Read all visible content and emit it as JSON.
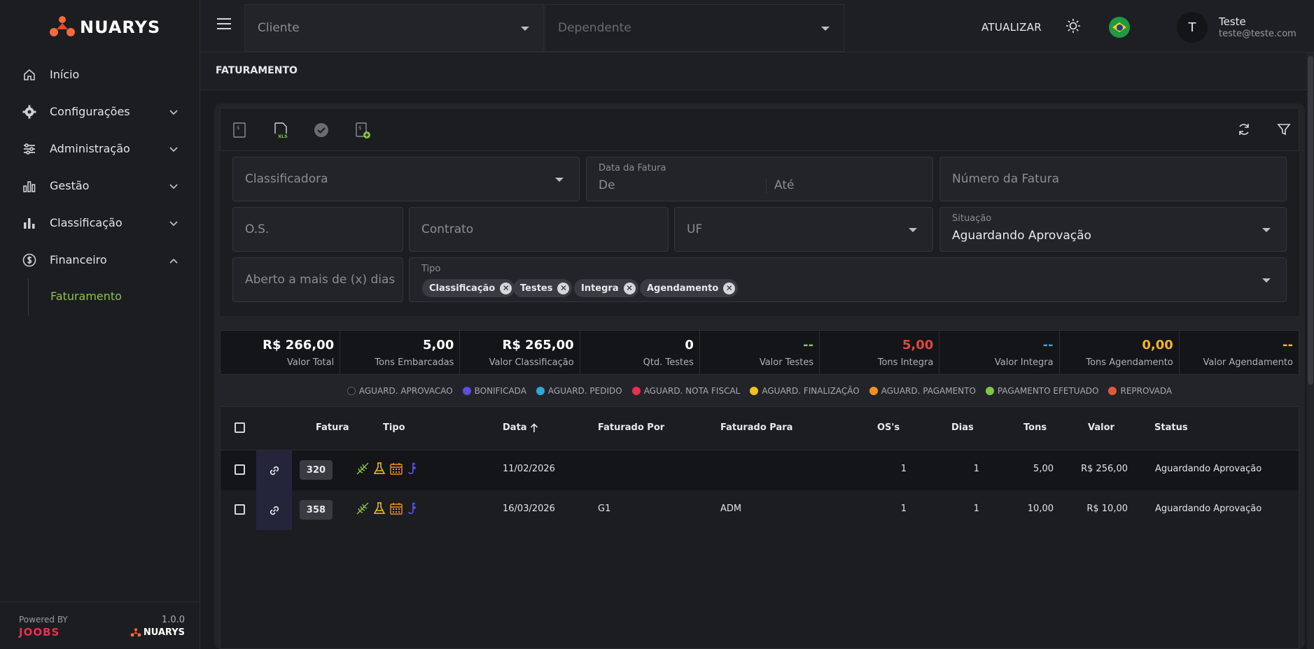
{
  "app": {
    "brand": "NUARYS"
  },
  "sidebar": {
    "items": [
      {
        "label": "Início",
        "icon": "home-icon"
      },
      {
        "label": "Configurações",
        "icon": "gear-icon"
      },
      {
        "label": "Administração",
        "icon": "sliders-icon"
      },
      {
        "label": "Gestão",
        "icon": "bar-chart-icon"
      },
      {
        "label": "Classificação",
        "icon": "bar-chart-icon"
      },
      {
        "label": "Financeiro",
        "icon": "dollar-circle-icon"
      }
    ],
    "subitem": "Faturamento",
    "powered_by": "Powered BY",
    "powered_brand": "JOOBS",
    "version": "1.0.0",
    "footer_brand": "NUARYS"
  },
  "topbar": {
    "cliente_placeholder": "Cliente",
    "dependente_placeholder": "Dependente",
    "atualizar": "ATUALIZAR",
    "avatar_letter": "T",
    "user_name": "Teste",
    "user_email": "teste@teste.com"
  },
  "page": {
    "title": "FATURAMENTO"
  },
  "filters": {
    "classificadora": "Classificadora",
    "data_label": "Data da Fatura",
    "de": "De",
    "ate": "Até",
    "numero": "Número da Fatura",
    "os": "O.S.",
    "contrato": "Contrato",
    "uf": "UF",
    "situacao_label": "Situação",
    "situacao_value": "Aguardando Aprovação",
    "aberto": "Aberto a mais de (x) dias",
    "tipo_label": "Tipo",
    "tipo_chips": [
      "Classificação",
      "Testes",
      "Integra",
      "Agendamento"
    ]
  },
  "kpis": [
    {
      "value": "R$ 266,00",
      "label": "Valor Total",
      "color": "#ffffff"
    },
    {
      "value": "5,00",
      "label": "Tons Embarcadas",
      "color": "#ffffff"
    },
    {
      "value": "R$ 265,00",
      "label": "Valor Classificação",
      "color": "#ffffff"
    },
    {
      "value": "0",
      "label": "Qtd. Testes",
      "color": "#ffffff"
    },
    {
      "value": "--",
      "label": "Valor Testes",
      "color": "#8bc34a"
    },
    {
      "value": "5,00",
      "label": "Tons Integra",
      "color": "#e0483c"
    },
    {
      "value": "--",
      "label": "Valor Integra",
      "color": "#29a8d8"
    },
    {
      "value": "0,00",
      "label": "Tons Agendamento",
      "color": "#f2b622"
    },
    {
      "value": "--",
      "label": "Valor Agendamento",
      "color": "#f2b622"
    }
  ],
  "legend": [
    {
      "label": "AGUARD. APROVACAO",
      "color": "#1c1d21"
    },
    {
      "label": "BONIFICADA",
      "color": "#5a4fe0"
    },
    {
      "label": "AGUARD. PEDIDO",
      "color": "#2fa8d8"
    },
    {
      "label": "AGUARD. NOTA FISCAL",
      "color": "#e8304f"
    },
    {
      "label": "AGUARD. FINALIZAÇÃO",
      "color": "#f2c122"
    },
    {
      "label": "AGUARD. PAGAMENTO",
      "color": "#f2901f"
    },
    {
      "label": "PAGAMENTO EFETUADO",
      "color": "#7ac943"
    },
    {
      "label": "REPROVADA",
      "color": "#e05a3a"
    }
  ],
  "table": {
    "headers": {
      "fatura": "Fatura",
      "tipo": "Tipo",
      "data": "Data",
      "faturado_por": "Faturado Por",
      "faturado_para": "Faturado Para",
      "os": "OS's",
      "dias": "Dias",
      "tons": "Tons",
      "valor": "Valor",
      "status": "Status"
    },
    "rows": [
      {
        "fatura": "320",
        "data": "11/02/2026",
        "faturado_por": "",
        "faturado_para": "",
        "os": "1",
        "dias": "1",
        "tons": "5,00",
        "valor": "R$ 256,00",
        "status": "Aguardando Aprovação"
      },
      {
        "fatura": "358",
        "data": "16/03/2026",
        "faturado_por": "G1",
        "faturado_para": "ADM",
        "os": "1",
        "dias": "1",
        "tons": "10,00",
        "valor": "R$ 10,00",
        "status": "Aguardando Aprovação"
      }
    ]
  }
}
